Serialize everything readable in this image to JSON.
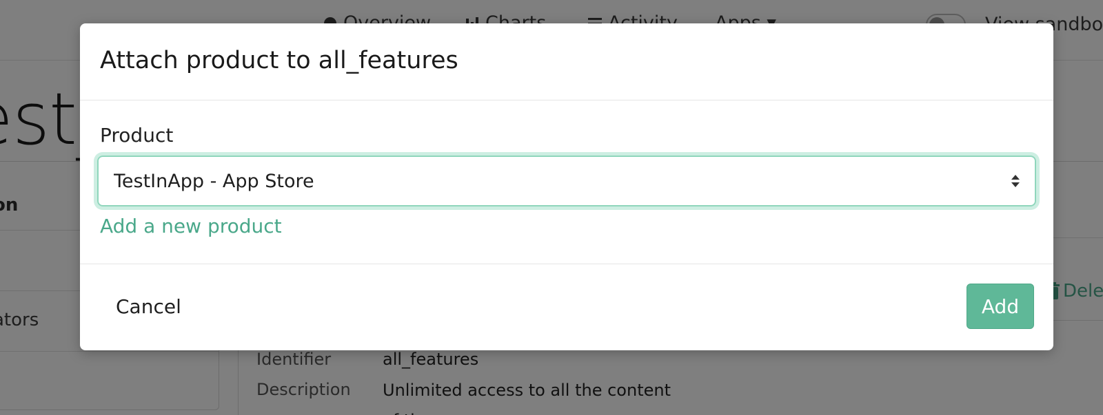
{
  "nav": {
    "overview_label": "Overview",
    "charts_label": "Charts",
    "activity_label": "Activity",
    "apps_label": "Apps ▾",
    "sandbox_label": "View sandbox"
  },
  "background": {
    "title_fragment": "est_",
    "left_items": [
      "on",
      "ators"
    ],
    "delete_label": "Dele",
    "details": [
      {
        "label": "Identifier",
        "value": "all_features"
      },
      {
        "label": "Description",
        "value": "Unlimited access to all the content of the app"
      }
    ]
  },
  "modal": {
    "title": "Attach product to all_features",
    "product_label": "Product",
    "product_selected": "TestInApp - App Store",
    "add_new_product_link": "Add a new product",
    "cancel_label": "Cancel",
    "add_label": "Add"
  },
  "colors": {
    "accent": "#5fb898",
    "link": "#4aa88a",
    "focus_ring": "#cdeee2"
  }
}
